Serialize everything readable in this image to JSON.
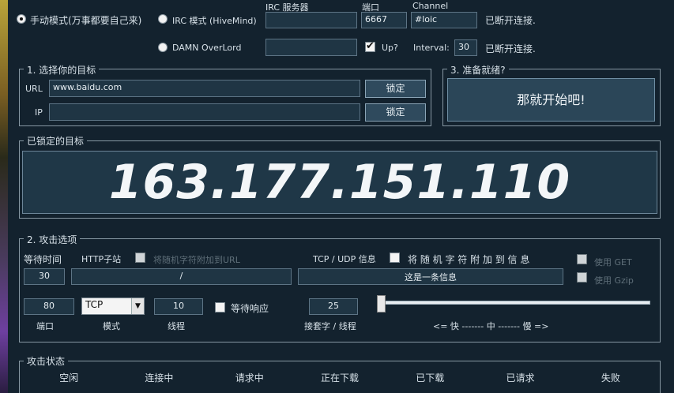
{
  "top": {
    "manual_mode_label": "手动模式(万事都要自己来)",
    "irc_mode_label": "IRC 模式 (HiveMind)",
    "damn_label": "DAMN OverLord",
    "irc_server_label": "IRC 服务器",
    "port_label": "端口",
    "channel_label": "Channel",
    "irc_server_value": "",
    "port_value": "6667",
    "channel_value": "#loic",
    "status_1": "已断开连接.",
    "overlord_value": "",
    "up_label": "Up?",
    "interval_label": "Interval:",
    "interval_value": "30",
    "status_2": "已断开连接."
  },
  "target_group": {
    "title": "1. 选择你的目标",
    "url_label": "URL",
    "url_value": "www.baidu.com",
    "lock_label": "锁定",
    "ip_label": "IP",
    "ip_value": "",
    "ip_lock_label": "锁定"
  },
  "ready_group": {
    "title": "3. 准备就绪?",
    "start_label": "那就开始吧!"
  },
  "locked_group": {
    "title": "已锁定的目标",
    "target": "163.177.151.110"
  },
  "attack_group": {
    "title": "2. 攻击选项",
    "wait_time_label": "等待时间",
    "wait_time_value": "30",
    "http_sub_label": "HTTP子站",
    "append_random_url_label": "将随机字符附加到URL",
    "http_path_value": "/",
    "tcp_udp_label": "TCP / UDP 信息",
    "append_random_msg_label": "将 随 机 字 符 附 加 到 信 息",
    "message_value": "这是一条信息",
    "use_get_label": "使用 GET",
    "use_gzip_label": "使用 Gzip",
    "port_value": "80",
    "port_label": "端口",
    "mode_value": "TCP",
    "mode_label": "模式",
    "threads_value": "10",
    "threads_label": "线程",
    "wait_response_label": "等待响应",
    "sockets_value": "25",
    "sockets_label": "接套字 / 线程",
    "speed_label": "<= 快 ------- 中 ------- 慢 =>",
    "speed_level": 0.0
  },
  "status_group": {
    "title": "攻击状态",
    "columns": [
      "空闲",
      "连接中",
      "请求中",
      "正在下载",
      "已下载",
      "已请求",
      "失败"
    ]
  }
}
